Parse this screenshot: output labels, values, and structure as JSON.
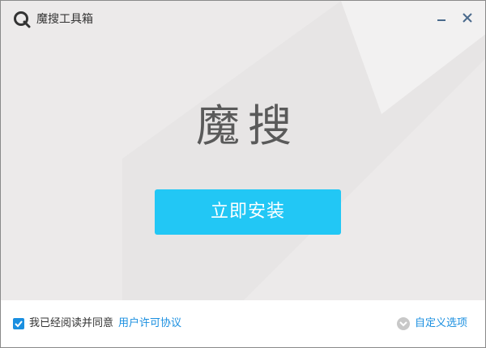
{
  "window": {
    "title": "魔搜工具箱",
    "minimize_icon": "minimize-icon",
    "close_icon": "close-icon",
    "logo_icon": "search-q-logo-icon"
  },
  "main": {
    "brand_name": "魔搜",
    "install_label": "立即安装"
  },
  "footer": {
    "agree_checked": true,
    "agree_text": "我已经阅读并同意",
    "license_link": "用户许可协议",
    "custom_options_label": "自定义选项",
    "custom_options_icon": "chevron-down-circle-icon"
  },
  "colors": {
    "accent": "#22c7f5",
    "link": "#1a8fe0",
    "background": "#eeeeee",
    "footer_background": "#ffffff"
  }
}
